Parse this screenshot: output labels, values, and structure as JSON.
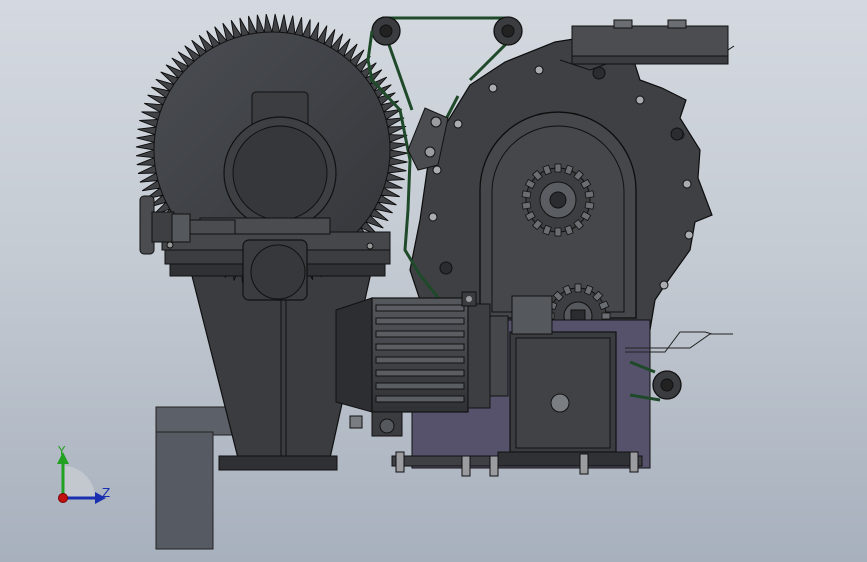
{
  "viewport": {
    "background_top": "#d4d9e0",
    "background_bottom": "#a7b0bd"
  },
  "model": {
    "part_color_dark": "#3c3e42",
    "part_color_mid": "#4e5155",
    "edge_color": "#0a0a0a",
    "belt_color": "#1f4a2a",
    "base_plate_color": "#5a5670",
    "post_color": "#5a5e66"
  },
  "triad": {
    "y_label": "Y",
    "z_label": "Z",
    "y_color": "#22a022",
    "z_color": "#1a2fb0",
    "x_color": "#c01010"
  }
}
